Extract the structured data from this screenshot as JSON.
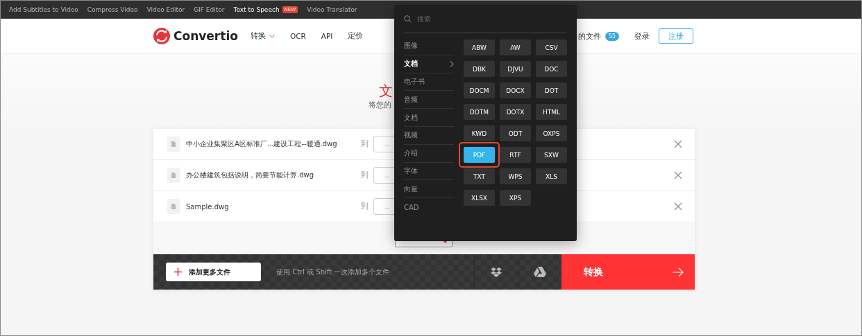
{
  "top_links": [
    {
      "label": "Add Subtitles to Video",
      "highlighted": false
    },
    {
      "label": "Compress Video",
      "highlighted": false
    },
    {
      "label": "Video Editor",
      "highlighted": false
    },
    {
      "label": "GIF Editor",
      "highlighted": false
    },
    {
      "label": "Text to Speech",
      "highlighted": true,
      "badge": "NEW"
    },
    {
      "label": "Video Translator",
      "highlighted": false
    }
  ],
  "header": {
    "logo": "Convertio",
    "nav": [
      {
        "label": "转换",
        "dropdown": true
      },
      {
        "label": "OCR",
        "dropdown": false
      },
      {
        "label": "API",
        "dropdown": false
      },
      {
        "label": "定价",
        "dropdown": false
      }
    ],
    "my_files": "的文件",
    "files_count": "55",
    "login": "登录",
    "signup": "注册"
  },
  "hero": {
    "title": "文",
    "subtitle": "将您的"
  },
  "files": [
    {
      "name": "中小企业集聚区A区标准厂...建设工程--暖通.dwg",
      "to": "到",
      "format": "..."
    },
    {
      "name": "办公楼建筑包括说明，简要节能计算.dwg",
      "to": "到",
      "format": "..."
    },
    {
      "name": "Sample.dwg",
      "to": "到",
      "format": "..."
    }
  ],
  "bottom": {
    "add_button": "添加更多文件",
    "hint": "使用 Ctrl 或 Shift 一次添加多个文件",
    "convert": "转换"
  },
  "popup": {
    "search_placeholder": "搜索",
    "categories": [
      {
        "label": "图像",
        "selected": false
      },
      {
        "label": "文档",
        "selected": true
      },
      {
        "label": "电子书",
        "selected": false
      },
      {
        "label": "音频",
        "selected": false
      },
      {
        "label": "文档",
        "selected": false
      },
      {
        "label": "视频",
        "selected": false
      },
      {
        "label": "介绍",
        "selected": false
      },
      {
        "label": "字体",
        "selected": false
      },
      {
        "label": "向量",
        "selected": false
      },
      {
        "label": "CAD",
        "selected": false
      }
    ],
    "formats": [
      {
        "label": "ABW",
        "selected": false
      },
      {
        "label": "AW",
        "selected": false
      },
      {
        "label": "CSV",
        "selected": false
      },
      {
        "label": "DBK",
        "selected": false
      },
      {
        "label": "DJVU",
        "selected": false
      },
      {
        "label": "DOC",
        "selected": false
      },
      {
        "label": "DOCM",
        "selected": false
      },
      {
        "label": "DOCX",
        "selected": false
      },
      {
        "label": "DOT",
        "selected": false
      },
      {
        "label": "DOTM",
        "selected": false
      },
      {
        "label": "DOTX",
        "selected": false
      },
      {
        "label": "HTML",
        "selected": false
      },
      {
        "label": "KWD",
        "selected": false
      },
      {
        "label": "ODT",
        "selected": false
      },
      {
        "label": "OXPS",
        "selected": false
      },
      {
        "label": "PDF",
        "selected": true
      },
      {
        "label": "RTF",
        "selected": false
      },
      {
        "label": "SXW",
        "selected": false
      },
      {
        "label": "TXT",
        "selected": false
      },
      {
        "label": "WPS",
        "selected": false
      },
      {
        "label": "XLS",
        "selected": false
      },
      {
        "label": "XLSX",
        "selected": false
      },
      {
        "label": "XPS",
        "selected": false
      }
    ]
  }
}
